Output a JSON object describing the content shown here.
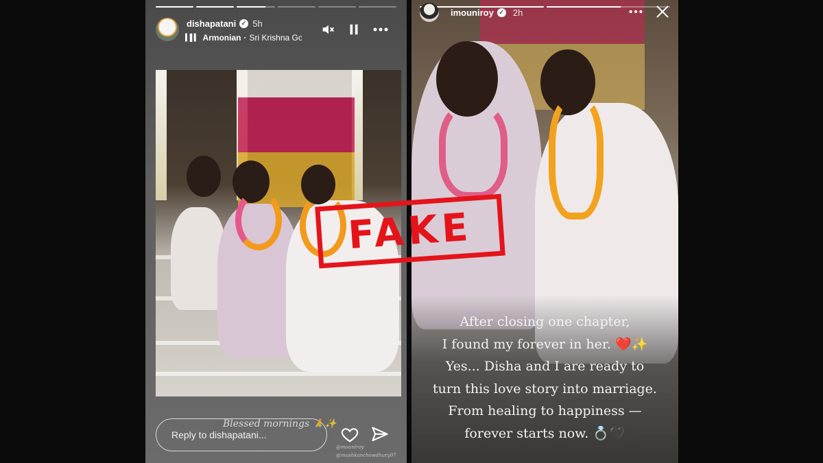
{
  "left_story": {
    "progress": [
      1,
      1,
      0.75,
      0,
      0,
      0
    ],
    "username": "dishapatani",
    "time": "5h",
    "music": {
      "artist": "Armonian",
      "separator": "·",
      "song": "Sri Krishna Gov"
    },
    "icons": {
      "mute": "speaker-muted-icon",
      "pause": "pause-icon",
      "more": "more-icon",
      "verified": "verified-icon"
    },
    "photo_watermark": "Blessed mornings 🙏✨",
    "credits": [
      "@mouniroy",
      "@mushkanchowdhury07"
    ],
    "reply_placeholder": "Reply to dishapatani...",
    "actions": {
      "like": "heart-icon",
      "share": "send-icon"
    }
  },
  "right_story": {
    "progress": [
      1,
      0.6
    ],
    "username": "imouniroy",
    "time": "2h",
    "icons": {
      "more": "more-icon",
      "close": "close-icon"
    },
    "caption_lines": [
      "After closing one chapter,",
      "I found my forever in her. ❤️✨",
      "Yes... Disha and I are ready to",
      "turn this love story into marriage.",
      "From healing to happiness —",
      "forever starts now. 💍🖤"
    ]
  },
  "stamp": {
    "text": "FAKE",
    "color": "#e4141b"
  }
}
